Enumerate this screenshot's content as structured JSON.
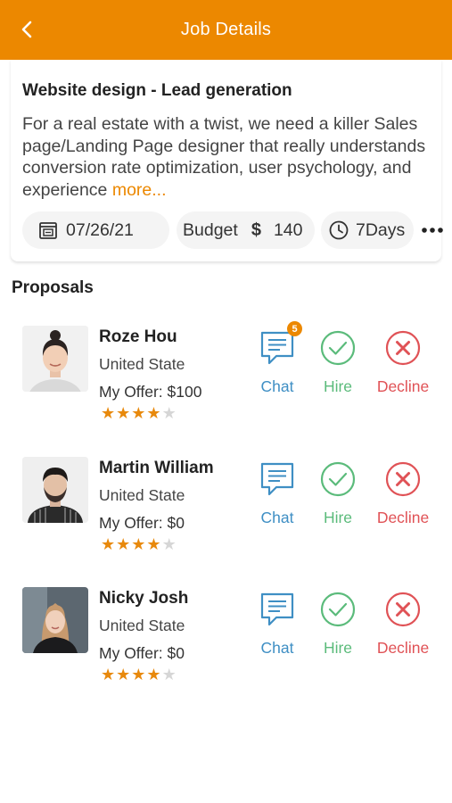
{
  "header": {
    "title": "Job Details",
    "back_icon": "chevron-left-icon"
  },
  "job": {
    "title": "Website design - Lead generation",
    "description": "For a real estate with a twist, we need a killer Sales page/Landing Page designer that really understands conversion rate optimization, user psychology, and experience",
    "more_label": "more...",
    "date": "07/26/21",
    "budget_label": "Budget",
    "budget_currency": "$",
    "budget_value": "140",
    "duration": "7Days"
  },
  "proposals_title": "Proposals",
  "proposals": [
    {
      "name": "Roze Hou",
      "location": "United State",
      "offer": "My Offer: $100",
      "rating": 4,
      "max_rating": 5,
      "chat_badge": "5",
      "chat_label": "Chat",
      "hire_label": "Hire",
      "decline_label": "Decline"
    },
    {
      "name": "Martin William",
      "location": "United State",
      "offer": "My Offer: $0",
      "rating": 4,
      "max_rating": 5,
      "chat_badge": "",
      "chat_label": "Chat",
      "hire_label": "Hire",
      "decline_label": "Decline"
    },
    {
      "name": "Nicky Josh",
      "location": "United State",
      "offer": "My Offer: $0",
      "rating": 4,
      "max_rating": 5,
      "chat_badge": "",
      "chat_label": "Chat",
      "hire_label": "Hire",
      "decline_label": "Decline"
    }
  ],
  "colors": {
    "accent": "#ec8800",
    "chat": "#3f8fc4",
    "hire": "#5bbb7b",
    "decline": "#e05256",
    "star": "#e8890c"
  }
}
